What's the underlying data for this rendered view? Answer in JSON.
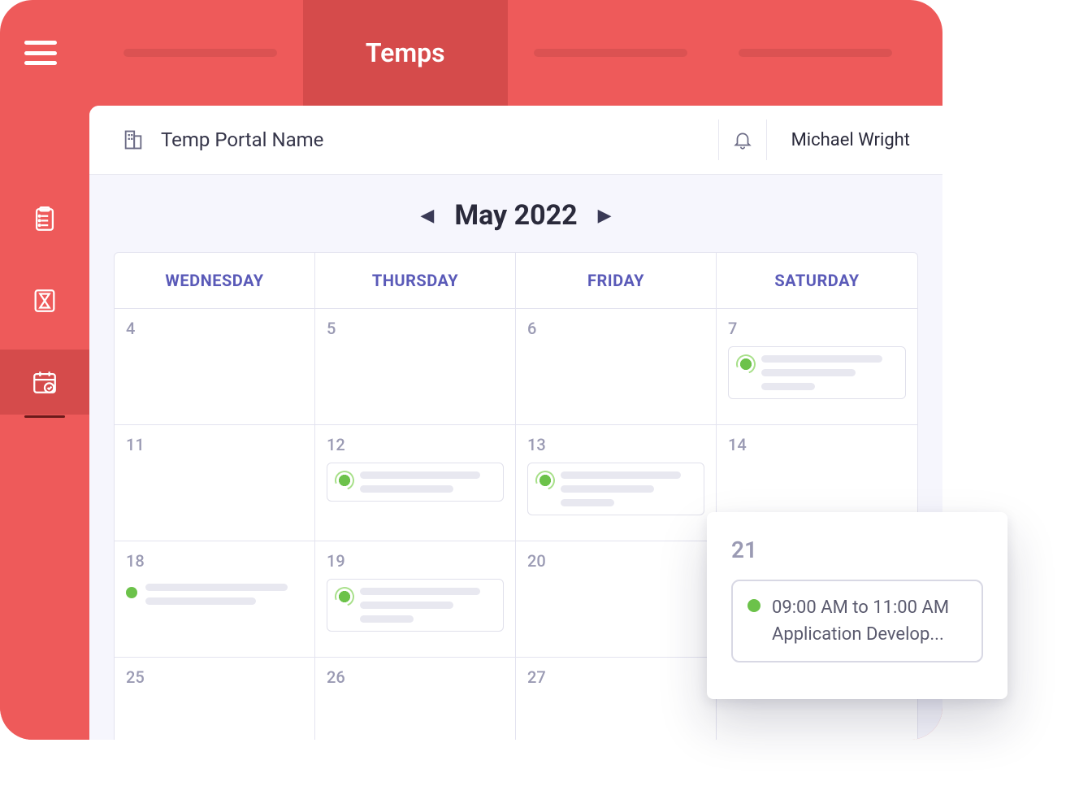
{
  "header": {
    "active_tab_label": "Temps",
    "portal_name": "Temp Portal Name",
    "user_name": "Michael Wright"
  },
  "calendar": {
    "month_label": "May 2022",
    "day_headers": [
      "WEDNESDAY",
      "THURSDAY",
      "FRIDAY",
      "SATURDAY"
    ],
    "weeks": [
      [
        {
          "day": "4"
        },
        {
          "day": "5"
        },
        {
          "day": "6"
        },
        {
          "day": "7",
          "event_placeholder": true,
          "lines": 3
        }
      ],
      [
        {
          "day": "11"
        },
        {
          "day": "12",
          "event_placeholder": true,
          "lines": 2
        },
        {
          "day": "13",
          "event_placeholder": true,
          "lines": 3
        },
        {
          "day": "14"
        }
      ],
      [
        {
          "day": "18",
          "event_simple": true,
          "lines": 2
        },
        {
          "day": "19",
          "event_placeholder": true,
          "lines": 3
        },
        {
          "day": "20"
        },
        {
          "day": "21"
        }
      ],
      [
        {
          "day": "25"
        },
        {
          "day": "26"
        },
        {
          "day": "27"
        },
        {
          "day": ""
        }
      ]
    ]
  },
  "popout": {
    "day": "21",
    "event_time": "09:00 AM to 11:00 AM",
    "event_title": "Application Develop..."
  }
}
